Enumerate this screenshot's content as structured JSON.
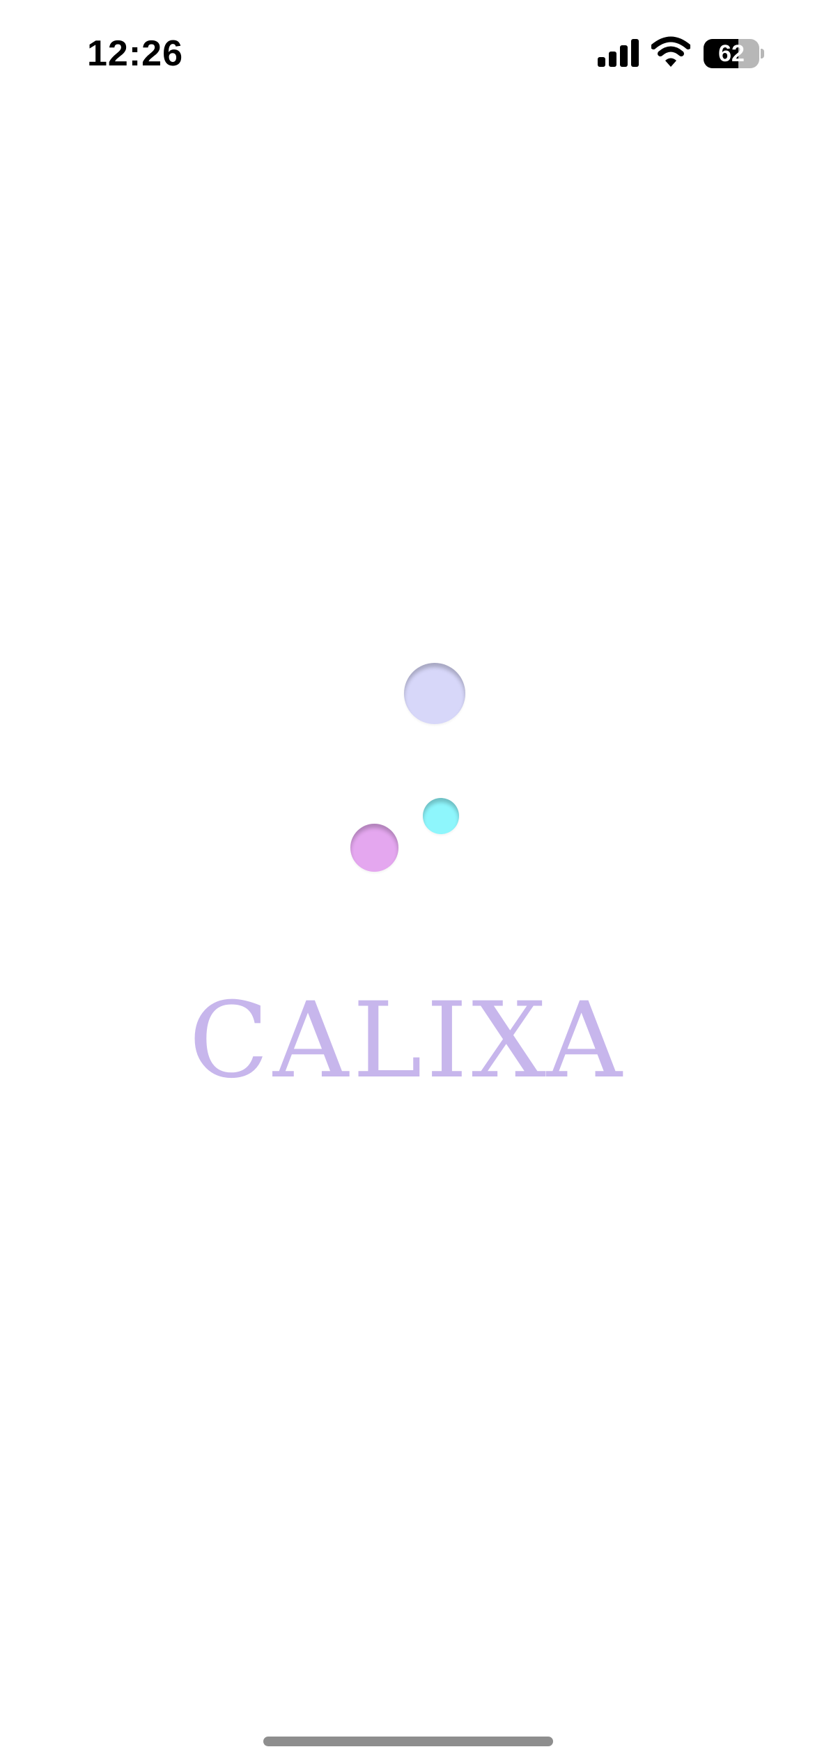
{
  "status_bar": {
    "time": "12:26",
    "battery_level": "62",
    "battery_fraction": 0.62,
    "icons": [
      "cellular-signal-icon",
      "wifi-icon",
      "battery-icon"
    ]
  },
  "splash": {
    "brand_name": "CALIXA",
    "colors": {
      "brand_text": "#c7b6ec",
      "bubble_large": "#d7d7f9",
      "bubble_cyan": "#8ef6fc",
      "bubble_pink": "#e4a7ef"
    }
  }
}
